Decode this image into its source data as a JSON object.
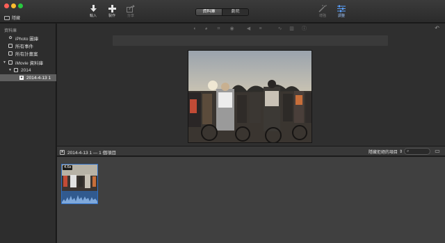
{
  "toolbar": {
    "hide_label": "隱藏",
    "buttons": [
      {
        "key": "import",
        "label": "輸入",
        "icon": "download-arrow-icon"
      },
      {
        "key": "create",
        "label": "製作",
        "icon": "plus-icon"
      },
      {
        "key": "share",
        "label": "分享",
        "icon": "share-icon"
      },
      {
        "key": "enhance",
        "label": "增強",
        "icon": "magic-wand-icon"
      },
      {
        "key": "adjust",
        "label": "調整",
        "icon": "adjust-sliders-icon"
      }
    ],
    "segments": [
      "資料庫",
      "劇院"
    ],
    "segment_selected": "資料庫"
  },
  "sidebar": {
    "header": "資料庫",
    "items": [
      {
        "label": "iPhoto 圖庫",
        "icon": "iphoto-icon",
        "level": 0
      },
      {
        "label": "所有事件",
        "icon": "events-icon",
        "level": 0
      },
      {
        "label": "所有計畫案",
        "icon": "projects-icon",
        "level": 0
      },
      {
        "label": "iMovie 資料庫",
        "icon": "library-icon",
        "level": 0
      },
      {
        "label": "2014",
        "icon": "folder-icon",
        "level": 1
      },
      {
        "label": "2014-4-13 1",
        "icon": "star-icon",
        "level": 2,
        "selected": true
      }
    ]
  },
  "browser": {
    "title": "2014-4-13 1 — 1 個項目",
    "filter_label": "隱藏拒絕的項目",
    "clip_duration": "4.6s"
  },
  "colors": {
    "accent": "#2f6fc4",
    "window_bg": "#1e1e1e",
    "sidebar_bg": "#2d2d2d",
    "viewer_bg": "#2f2f2f",
    "browser_bg": "#404040"
  }
}
